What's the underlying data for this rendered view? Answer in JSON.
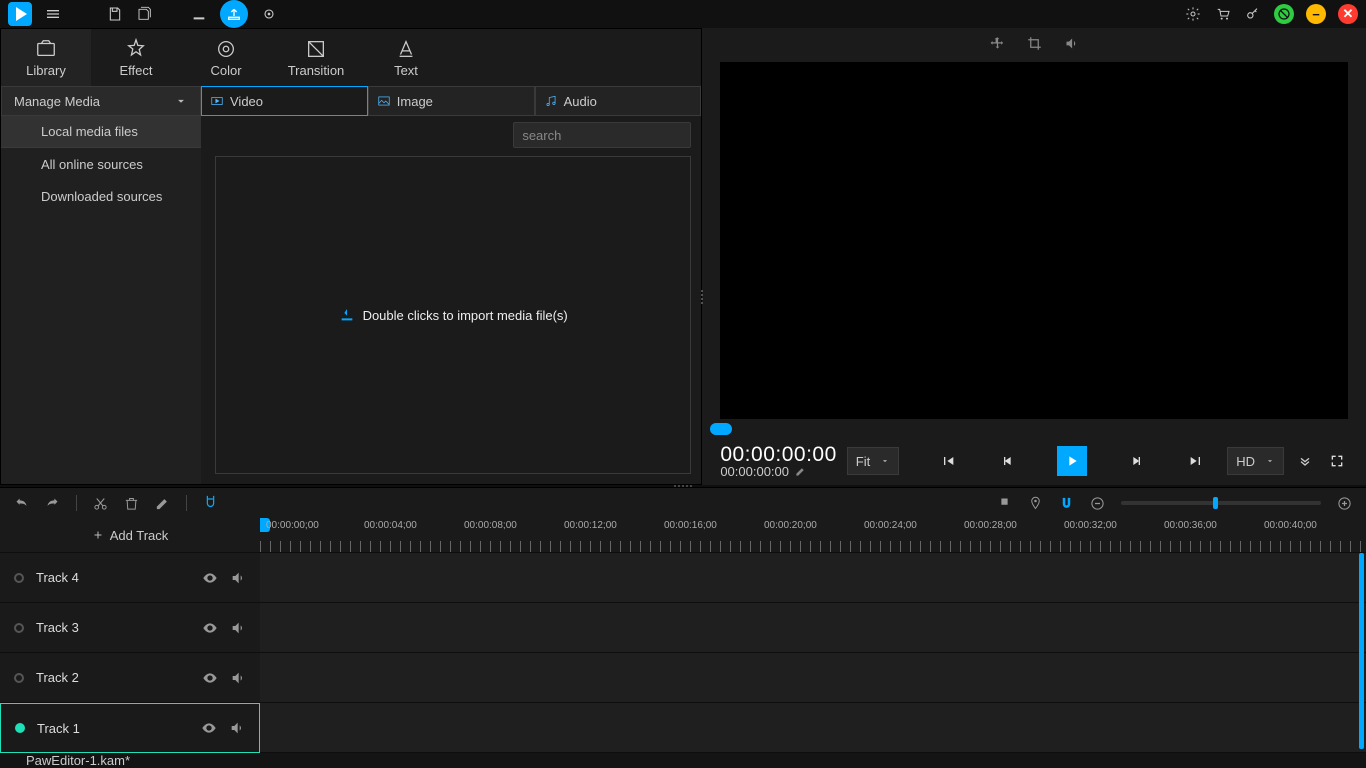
{
  "titlebar": {},
  "tabs": {
    "library": "Library",
    "effect": "Effect",
    "color": "Color",
    "transition": "Transition",
    "text": "Text"
  },
  "sidebar": {
    "manage": "Manage Media",
    "items": [
      "Local media files",
      "All online sources",
      "Downloaded sources"
    ]
  },
  "mediatabs": {
    "video": "Video",
    "image": "Image",
    "audio": "Audio"
  },
  "search": {
    "placeholder": "search"
  },
  "drop": {
    "label": "Double clicks to import media file(s)"
  },
  "preview": {
    "tc_main": "00:00:00:00",
    "tc_sub": "00:00:00:00",
    "fit": "Fit",
    "hd": "HD"
  },
  "timeline": {
    "addtrack": "Add Track",
    "tracks": [
      "Track 4",
      "Track 3",
      "Track 2",
      "Track 1"
    ],
    "marks": [
      "00:00:00;00",
      "00:00:04;00",
      "00:00:08;00",
      "00:00:12;00",
      "00:00:16;00",
      "00:00:20;00",
      "00:00:24;00",
      "00:00:28;00",
      "00:00:32;00",
      "00:00:36;00",
      "00:00:40;00"
    ]
  },
  "status": {
    "filename": "PawEditor-1.kam*"
  }
}
